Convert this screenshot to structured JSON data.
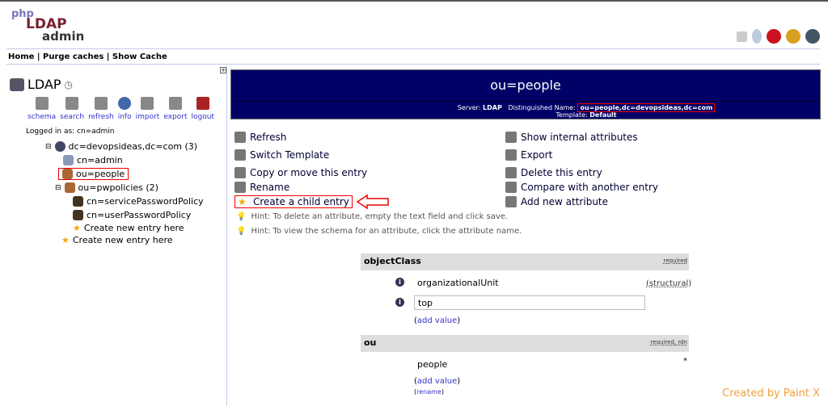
{
  "logo": {
    "line1": "php",
    "line2": "LDAP",
    "line3": "admin"
  },
  "nav": "Home | Purge caches | Show Cache",
  "top_icons": [
    "help-icon",
    "bulb-icon",
    "bug-icon",
    "smiley-icon",
    "question-icon"
  ],
  "left": {
    "server": "LDAP",
    "tools": [
      "schema",
      "search",
      "refresh",
      "info",
      "import",
      "export",
      "logout"
    ],
    "logged_in": "Logged in as: cn=admin",
    "tree": [
      "dc=devopsideas,dc=com (3)",
      "cn=admin",
      "ou=people",
      "ou=pwpolicies (2)",
      "cn=servicePasswordPolicy",
      "cn=userPasswordPolicy",
      "Create new entry here",
      "Create new entry here"
    ]
  },
  "header": {
    "title": "ou=people",
    "server_label": "Server:",
    "server": "LDAP",
    "dn_label": "Distinguished Name:",
    "dn": "ou=people,dc=devopsideas,dc=com",
    "template_label": "Template:",
    "template": "Default"
  },
  "actions_left": [
    "Refresh",
    "Switch Template",
    "Copy or move this entry",
    "Rename",
    "Create a child entry"
  ],
  "actions_right": [
    "Show internal attributes",
    "Export",
    "Delete this entry",
    "Compare with another entry",
    "Add new attribute"
  ],
  "hints": [
    "Hint: To delete an attribute, empty the text field and click save.",
    "Hint: To view the schema for an attribute, click the attribute name."
  ],
  "attributes": {
    "oc": {
      "name": "objectClass",
      "flags": "required",
      "values": [
        "organizationalUnit",
        "top"
      ],
      "structural": "(structural)",
      "add": "add value"
    },
    "ou": {
      "name": "ou",
      "flags": "required, rdn",
      "values": [
        "people"
      ],
      "star": "*",
      "add": "add value",
      "rename": "rename"
    }
  },
  "watermark": "Created by Paint X"
}
